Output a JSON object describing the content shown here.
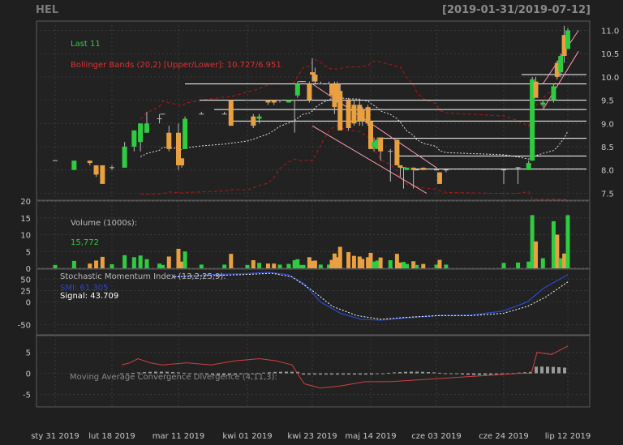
{
  "header": {
    "symbol": "HEL",
    "range": "[2019-01-31/2019-07-12]"
  },
  "colors": {
    "background": "#1f1f1f",
    "panel": "#222222",
    "grid": "#3a3a3a",
    "axis_text": "#c8c8c8",
    "up": "#2ecc40",
    "down": "#e8a040",
    "bband": "#b01818",
    "sma": "#dddddd",
    "smi_line": "#2a48c8",
    "signal": "#ffffff",
    "macd_line": "#d04040",
    "macd_hist": "#9a9a9a",
    "hline": "#ffffff",
    "channel": "#ff9ab0"
  },
  "chart_data": [
    {
      "type": "candlestick",
      "title": "",
      "legend": [
        {
          "label": "Last 11",
          "color": "#2ecc40"
        },
        {
          "label": "Bollinger Bands (20,2) [Upper/Lower]: 10.727/6.951",
          "color": "#e03030"
        }
      ],
      "ylim": [
        7.35,
        11.2
      ],
      "yticks": [
        "7.5",
        "8.0",
        "8.5",
        "9.0",
        "9.5",
        "10.0",
        "10.5",
        "11.0"
      ],
      "horizontal_levels": [
        10.05,
        9.85,
        9.5,
        9.3,
        9.05,
        8.68,
        8.3,
        8.02
      ],
      "trend_channels": [
        {
          "from": [
            "2019-04-23",
            9.85
          ],
          "to": [
            "2019-06-03",
            8.05
          ]
        },
        {
          "from": [
            "2019-04-23",
            8.95
          ],
          "to": [
            "2019-05-31",
            7.5
          ]
        },
        {
          "from": [
            "2019-07-05",
            9.85
          ],
          "to": [
            "2019-07-15",
            11.0
          ]
        },
        {
          "from": [
            "2019-07-05",
            9.3
          ],
          "to": [
            "2019-07-15",
            10.55
          ]
        }
      ],
      "series": [
        {
          "date": "2019-01-31",
          "open": 8.2,
          "high": 8.2,
          "low": 8.2,
          "close": 8.2
        },
        {
          "date": "2019-02-06",
          "open": 8.0,
          "high": 8.2,
          "low": 8.0,
          "close": 8.2
        },
        {
          "date": "2019-02-11",
          "open": 8.2,
          "high": 8.2,
          "low": 8.1,
          "close": 8.15
        },
        {
          "date": "2019-02-13",
          "open": 8.1,
          "high": 8.1,
          "low": 7.85,
          "close": 7.9
        },
        {
          "date": "2019-02-15",
          "open": 8.1,
          "high": 8.1,
          "low": 7.7,
          "close": 7.7
        },
        {
          "date": "2019-02-18",
          "open": 8.05,
          "high": 8.1,
          "low": 8.0,
          "close": 8.05
        },
        {
          "date": "2019-02-22",
          "open": 8.05,
          "high": 8.6,
          "low": 8.05,
          "close": 8.5
        },
        {
          "date": "2019-02-25",
          "open": 8.5,
          "high": 8.85,
          "low": 8.4,
          "close": 8.85
        },
        {
          "date": "2019-02-27",
          "open": 8.6,
          "high": 9.0,
          "low": 8.4,
          "close": 9.0
        },
        {
          "date": "2019-03-01",
          "open": 8.8,
          "high": 9.25,
          "low": 8.8,
          "close": 9.0
        },
        {
          "date": "2019-03-05",
          "open": 9.1,
          "high": 9.2,
          "low": 9.0,
          "close": 9.1
        },
        {
          "date": "2019-03-06",
          "open": 9.2,
          "high": 9.2,
          "low": 9.2,
          "close": 9.2
        },
        {
          "date": "2019-03-08",
          "open": 8.8,
          "high": 8.95,
          "low": 8.4,
          "close": 8.45
        },
        {
          "date": "2019-03-11",
          "open": 8.8,
          "high": 9.0,
          "low": 8.0,
          "close": 8.1
        },
        {
          "date": "2019-03-12",
          "open": 8.25,
          "high": 8.25,
          "low": 8.05,
          "close": 8.1
        },
        {
          "date": "2019-03-13",
          "open": 8.45,
          "high": 9.15,
          "low": 8.45,
          "close": 9.1
        },
        {
          "date": "2019-03-18",
          "open": 9.2,
          "high": 9.25,
          "low": 9.2,
          "close": 9.2
        },
        {
          "date": "2019-03-25",
          "open": 9.2,
          "high": 9.25,
          "low": 9.2,
          "close": 9.2
        },
        {
          "date": "2019-03-27",
          "open": 9.5,
          "high": 9.5,
          "low": 8.95,
          "close": 8.95
        },
        {
          "date": "2019-04-01",
          "open": 9.5,
          "high": 9.5,
          "low": 9.5,
          "close": 9.5
        },
        {
          "date": "2019-04-03",
          "open": 9.15,
          "high": 9.2,
          "low": 8.9,
          "close": 8.95
        },
        {
          "date": "2019-04-05",
          "open": 9.1,
          "high": 9.2,
          "low": 9.0,
          "close": 9.15
        },
        {
          "date": "2019-04-08",
          "open": 9.5,
          "high": 9.5,
          "low": 9.4,
          "close": 9.45
        },
        {
          "date": "2019-04-10",
          "open": 9.5,
          "high": 9.5,
          "low": 9.4,
          "close": 9.45
        },
        {
          "date": "2019-04-12",
          "open": 9.5,
          "high": 9.5,
          "low": 9.45,
          "close": 9.5
        },
        {
          "date": "2019-04-15",
          "open": 9.45,
          "high": 9.5,
          "low": 9.45,
          "close": 9.5
        },
        {
          "date": "2019-04-17",
          "open": 9.5,
          "high": 9.5,
          "low": 8.8,
          "close": 9.5
        },
        {
          "date": "2019-04-18",
          "open": 9.6,
          "high": 9.9,
          "low": 9.55,
          "close": 9.85
        },
        {
          "date": "2019-04-19",
          "open": 9.9,
          "high": 9.9,
          "low": 9.9,
          "close": 9.9
        },
        {
          "date": "2019-04-20",
          "open": 9.9,
          "high": 9.9,
          "low": 9.9,
          "close": 9.9
        },
        {
          "date": "2019-04-22",
          "open": 9.85,
          "high": 9.9,
          "low": 9.45,
          "close": 9.5
        },
        {
          "date": "2019-04-23",
          "open": 10.1,
          "high": 10.4,
          "low": 9.9,
          "close": 10.05
        },
        {
          "date": "2019-04-24",
          "open": 10.05,
          "high": 10.2,
          "low": 9.85,
          "close": 9.9
        },
        {
          "date": "2019-04-26",
          "open": 9.85,
          "high": 9.9,
          "low": 9.85,
          "close": 9.85
        },
        {
          "date": "2019-04-29",
          "open": 9.85,
          "high": 9.9,
          "low": 9.85,
          "close": 9.85
        },
        {
          "date": "2019-04-30",
          "open": 9.85,
          "high": 9.85,
          "low": 9.6,
          "close": 9.6
        },
        {
          "date": "2019-05-01",
          "open": 9.85,
          "high": 9.9,
          "low": 9.2,
          "close": 9.35
        },
        {
          "date": "2019-05-02",
          "open": 9.85,
          "high": 9.9,
          "low": 9.45,
          "close": 9.5
        },
        {
          "date": "2019-05-03",
          "open": 9.7,
          "high": 9.85,
          "low": 8.85,
          "close": 8.85
        },
        {
          "date": "2019-05-06",
          "open": 9.5,
          "high": 9.55,
          "low": 8.85,
          "close": 8.9
        },
        {
          "date": "2019-05-08",
          "open": 9.4,
          "high": 9.5,
          "low": 8.95,
          "close": 9.0
        },
        {
          "date": "2019-05-10",
          "open": 9.4,
          "high": 9.5,
          "low": 8.95,
          "close": 9.05
        },
        {
          "date": "2019-05-11",
          "open": 9.3,
          "high": 9.35,
          "low": 8.95,
          "close": 9.05
        },
        {
          "date": "2019-05-13",
          "open": 9.35,
          "high": 9.4,
          "low": 8.95,
          "close": 9.0
        },
        {
          "date": "2019-05-14",
          "open": 9.05,
          "high": 9.05,
          "low": 8.45,
          "close": 8.45
        },
        {
          "date": "2019-05-15",
          "open": 8.5,
          "high": 8.7,
          "low": 8.4,
          "close": 8.6
        },
        {
          "date": "2019-05-16",
          "open": 8.45,
          "high": 8.7,
          "low": 8.45,
          "close": 8.65
        },
        {
          "date": "2019-05-17",
          "open": 8.7,
          "high": 8.7,
          "low": 8.2,
          "close": 8.4
        },
        {
          "date": "2019-05-20",
          "open": 8.4,
          "high": 8.45,
          "low": 7.75,
          "close": 8.4
        },
        {
          "date": "2019-05-22",
          "open": 8.65,
          "high": 8.65,
          "low": 8.1,
          "close": 8.1
        },
        {
          "date": "2019-05-23",
          "open": 8.1,
          "high": 8.1,
          "low": 7.85,
          "close": 8.05
        },
        {
          "date": "2019-05-24",
          "open": 8.05,
          "high": 8.05,
          "low": 7.6,
          "close": 8.05
        },
        {
          "date": "2019-05-25",
          "open": 8.0,
          "high": 8.05,
          "low": 8.0,
          "close": 8.05
        },
        {
          "date": "2019-05-27",
          "open": 8.05,
          "high": 8.05,
          "low": 7.6,
          "close": 8.0
        },
        {
          "date": "2019-05-28",
          "open": 8.0,
          "high": 8.0,
          "low": 8.0,
          "close": 8.0
        },
        {
          "date": "2019-05-30",
          "open": 8.05,
          "high": 8.05,
          "low": 8.0,
          "close": 8.0
        },
        {
          "date": "2019-06-03",
          "open": 8.0,
          "high": 8.05,
          "low": 8.0,
          "close": 8.0
        },
        {
          "date": "2019-06-04",
          "open": 7.95,
          "high": 7.95,
          "low": 7.7,
          "close": 7.7
        },
        {
          "date": "2019-06-06",
          "open": 8.0,
          "high": 8.0,
          "low": 7.95,
          "close": 8.0
        },
        {
          "date": "2019-06-24",
          "open": 8.0,
          "high": 8.0,
          "low": 7.7,
          "close": 8.0
        },
        {
          "date": "2019-06-28",
          "open": 8.05,
          "high": 8.05,
          "low": 7.7,
          "close": 8.05
        },
        {
          "date": "2019-07-01",
          "open": 8.0,
          "high": 8.2,
          "low": 8.0,
          "close": 8.15
        },
        {
          "date": "2019-07-02",
          "open": 8.2,
          "high": 10.0,
          "low": 8.2,
          "close": 9.95
        },
        {
          "date": "2019-07-03",
          "open": 9.9,
          "high": 10.0,
          "low": 9.55,
          "close": 9.55
        },
        {
          "date": "2019-07-05",
          "open": 9.4,
          "high": 9.5,
          "low": 9.35,
          "close": 9.45
        },
        {
          "date": "2019-07-08",
          "open": 9.5,
          "high": 9.85,
          "low": 9.45,
          "close": 9.8
        },
        {
          "date": "2019-07-09",
          "open": 10.3,
          "high": 10.35,
          "low": 9.95,
          "close": 10.0
        },
        {
          "date": "2019-07-10",
          "open": 10.1,
          "high": 10.5,
          "low": 10.0,
          "close": 10.45
        },
        {
          "date": "2019-07-11",
          "open": 10.9,
          "high": 11.1,
          "low": 10.3,
          "close": 10.45
        },
        {
          "date": "2019-07-12",
          "open": 10.6,
          "high": 11.05,
          "low": 10.6,
          "close": 11.0
        }
      ]
    },
    {
      "type": "bar",
      "title": "Volume (1000s):",
      "value_label": "15,772",
      "ylim": [
        0,
        20
      ],
      "yticks": [
        "0",
        "5",
        "10",
        "15",
        "20"
      ]
    },
    {
      "type": "line",
      "title": "Stochastic Momentum Index (13,2,25,9):",
      "value_labels": [
        {
          "label": "SMI: 61.305",
          "color": "#2a48c8"
        },
        {
          "label": "Signal: 43.709",
          "color": "#ffffff"
        }
      ],
      "ylim": [
        -72,
        72
      ],
      "yticks": [
        "-50",
        "0",
        "25",
        "50"
      ]
    },
    {
      "type": "line",
      "title": "Moving Average Convergence Divergence (4,11,3):",
      "ylim": [
        -8,
        9
      ],
      "yticks": [
        "-5",
        "0",
        "5"
      ]
    }
  ],
  "x_axis": {
    "labels": [
      {
        "label": "sty 31 2019",
        "date": "2019-01-31"
      },
      {
        "label": "lut 18 2019",
        "date": "2019-02-18"
      },
      {
        "label": "mar 11 2019",
        "date": "2019-03-11"
      },
      {
        "label": "kwi 01 2019",
        "date": "2019-04-01"
      },
      {
        "label": "kwi 23 2019",
        "date": "2019-04-23"
      },
      {
        "label": "maj 14 2019",
        "date": "2019-05-14"
      },
      {
        "label": "cze 03 2019",
        "date": "2019-06-03"
      },
      {
        "label": "cze 24 2019",
        "date": "2019-06-24"
      },
      {
        "label": "lip 12 2019",
        "date": "2019-07-12"
      }
    ]
  }
}
